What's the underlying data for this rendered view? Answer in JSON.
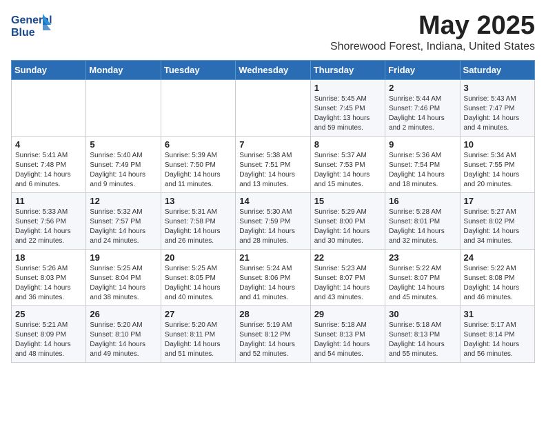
{
  "header": {
    "logo_line1": "General",
    "logo_line2": "Blue",
    "title": "May 2025",
    "subtitle": "Shorewood Forest, Indiana, United States"
  },
  "weekdays": [
    "Sunday",
    "Monday",
    "Tuesday",
    "Wednesday",
    "Thursday",
    "Friday",
    "Saturday"
  ],
  "weeks": [
    [
      {
        "day": "",
        "detail": ""
      },
      {
        "day": "",
        "detail": ""
      },
      {
        "day": "",
        "detail": ""
      },
      {
        "day": "",
        "detail": ""
      },
      {
        "day": "1",
        "detail": "Sunrise: 5:45 AM\nSunset: 7:45 PM\nDaylight: 13 hours\nand 59 minutes."
      },
      {
        "day": "2",
        "detail": "Sunrise: 5:44 AM\nSunset: 7:46 PM\nDaylight: 14 hours\nand 2 minutes."
      },
      {
        "day": "3",
        "detail": "Sunrise: 5:43 AM\nSunset: 7:47 PM\nDaylight: 14 hours\nand 4 minutes."
      }
    ],
    [
      {
        "day": "4",
        "detail": "Sunrise: 5:41 AM\nSunset: 7:48 PM\nDaylight: 14 hours\nand 6 minutes."
      },
      {
        "day": "5",
        "detail": "Sunrise: 5:40 AM\nSunset: 7:49 PM\nDaylight: 14 hours\nand 9 minutes."
      },
      {
        "day": "6",
        "detail": "Sunrise: 5:39 AM\nSunset: 7:50 PM\nDaylight: 14 hours\nand 11 minutes."
      },
      {
        "day": "7",
        "detail": "Sunrise: 5:38 AM\nSunset: 7:51 PM\nDaylight: 14 hours\nand 13 minutes."
      },
      {
        "day": "8",
        "detail": "Sunrise: 5:37 AM\nSunset: 7:53 PM\nDaylight: 14 hours\nand 15 minutes."
      },
      {
        "day": "9",
        "detail": "Sunrise: 5:36 AM\nSunset: 7:54 PM\nDaylight: 14 hours\nand 18 minutes."
      },
      {
        "day": "10",
        "detail": "Sunrise: 5:34 AM\nSunset: 7:55 PM\nDaylight: 14 hours\nand 20 minutes."
      }
    ],
    [
      {
        "day": "11",
        "detail": "Sunrise: 5:33 AM\nSunset: 7:56 PM\nDaylight: 14 hours\nand 22 minutes."
      },
      {
        "day": "12",
        "detail": "Sunrise: 5:32 AM\nSunset: 7:57 PM\nDaylight: 14 hours\nand 24 minutes."
      },
      {
        "day": "13",
        "detail": "Sunrise: 5:31 AM\nSunset: 7:58 PM\nDaylight: 14 hours\nand 26 minutes."
      },
      {
        "day": "14",
        "detail": "Sunrise: 5:30 AM\nSunset: 7:59 PM\nDaylight: 14 hours\nand 28 minutes."
      },
      {
        "day": "15",
        "detail": "Sunrise: 5:29 AM\nSunset: 8:00 PM\nDaylight: 14 hours\nand 30 minutes."
      },
      {
        "day": "16",
        "detail": "Sunrise: 5:28 AM\nSunset: 8:01 PM\nDaylight: 14 hours\nand 32 minutes."
      },
      {
        "day": "17",
        "detail": "Sunrise: 5:27 AM\nSunset: 8:02 PM\nDaylight: 14 hours\nand 34 minutes."
      }
    ],
    [
      {
        "day": "18",
        "detail": "Sunrise: 5:26 AM\nSunset: 8:03 PM\nDaylight: 14 hours\nand 36 minutes."
      },
      {
        "day": "19",
        "detail": "Sunrise: 5:25 AM\nSunset: 8:04 PM\nDaylight: 14 hours\nand 38 minutes."
      },
      {
        "day": "20",
        "detail": "Sunrise: 5:25 AM\nSunset: 8:05 PM\nDaylight: 14 hours\nand 40 minutes."
      },
      {
        "day": "21",
        "detail": "Sunrise: 5:24 AM\nSunset: 8:06 PM\nDaylight: 14 hours\nand 41 minutes."
      },
      {
        "day": "22",
        "detail": "Sunrise: 5:23 AM\nSunset: 8:07 PM\nDaylight: 14 hours\nand 43 minutes."
      },
      {
        "day": "23",
        "detail": "Sunrise: 5:22 AM\nSunset: 8:07 PM\nDaylight: 14 hours\nand 45 minutes."
      },
      {
        "day": "24",
        "detail": "Sunrise: 5:22 AM\nSunset: 8:08 PM\nDaylight: 14 hours\nand 46 minutes."
      }
    ],
    [
      {
        "day": "25",
        "detail": "Sunrise: 5:21 AM\nSunset: 8:09 PM\nDaylight: 14 hours\nand 48 minutes."
      },
      {
        "day": "26",
        "detail": "Sunrise: 5:20 AM\nSunset: 8:10 PM\nDaylight: 14 hours\nand 49 minutes."
      },
      {
        "day": "27",
        "detail": "Sunrise: 5:20 AM\nSunset: 8:11 PM\nDaylight: 14 hours\nand 51 minutes."
      },
      {
        "day": "28",
        "detail": "Sunrise: 5:19 AM\nSunset: 8:12 PM\nDaylight: 14 hours\nand 52 minutes."
      },
      {
        "day": "29",
        "detail": "Sunrise: 5:18 AM\nSunset: 8:13 PM\nDaylight: 14 hours\nand 54 minutes."
      },
      {
        "day": "30",
        "detail": "Sunrise: 5:18 AM\nSunset: 8:13 PM\nDaylight: 14 hours\nand 55 minutes."
      },
      {
        "day": "31",
        "detail": "Sunrise: 5:17 AM\nSunset: 8:14 PM\nDaylight: 14 hours\nand 56 minutes."
      }
    ]
  ]
}
